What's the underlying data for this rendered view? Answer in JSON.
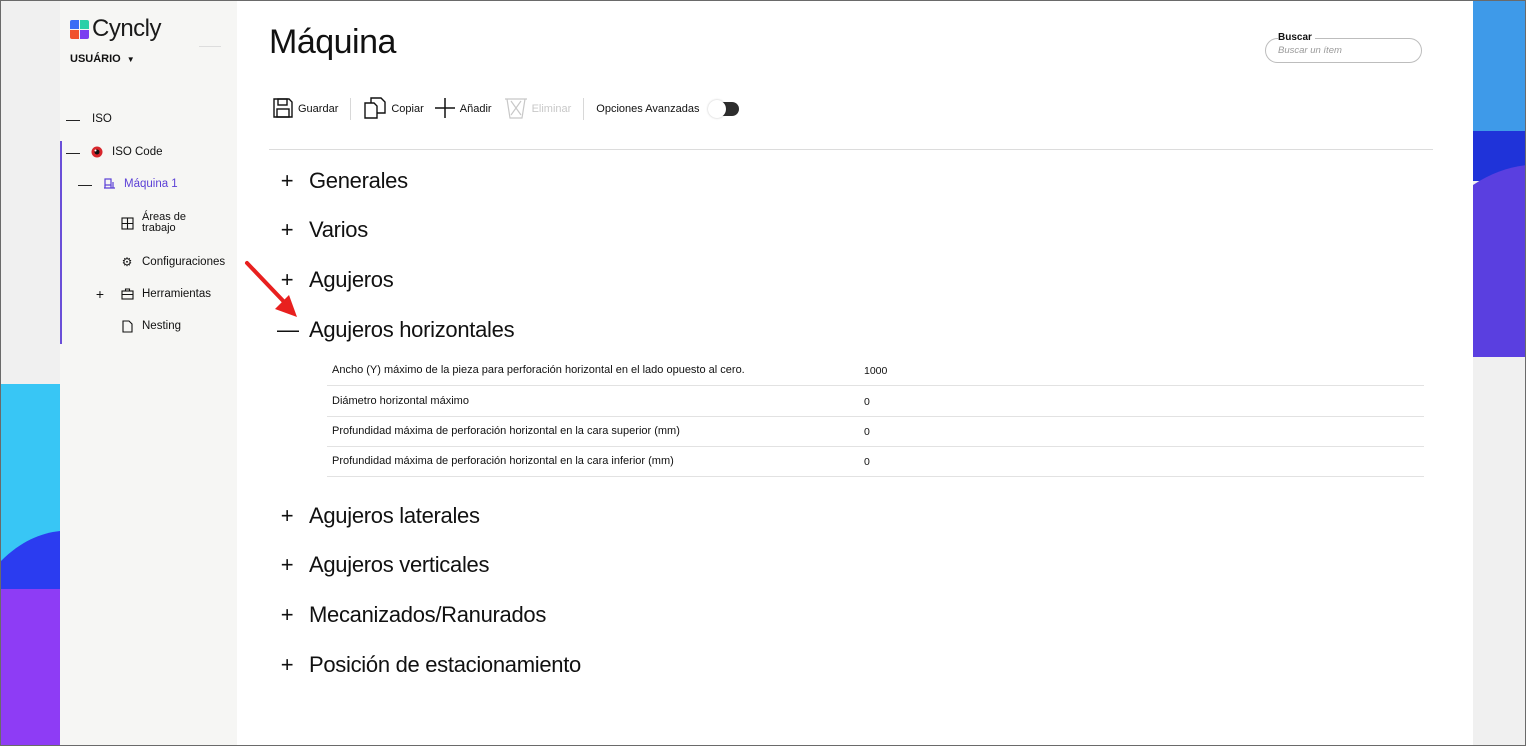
{
  "app": {
    "brand": "Cyncly",
    "user_menu": "USUÁRIO",
    "logo_colors": [
      "#3b6cf5",
      "#2bd0a8",
      "#f0532d",
      "#7b3cf0"
    ]
  },
  "sidebar": {
    "items": [
      {
        "toggle": "—",
        "icon": "",
        "label": "ISO"
      },
      {
        "toggle": "—",
        "icon": "iso-code-icon",
        "label": "ISO Code"
      },
      {
        "toggle": "—",
        "icon": "machine-icon",
        "label": "Máquina 1",
        "active": true
      },
      {
        "toggle": "",
        "icon": "grid-icon",
        "label": "Áreas de\ntrabajo"
      },
      {
        "toggle": "",
        "icon": "gear-icon",
        "label": "Configuraciones"
      },
      {
        "toggle": "+",
        "icon": "toolbox-icon",
        "label": "Herramientas"
      },
      {
        "toggle": "",
        "icon": "document-icon",
        "label": "Nesting"
      }
    ],
    "active_color": "#5b3fd6"
  },
  "main": {
    "title": "Máquina",
    "search": {
      "label": "Buscar",
      "placeholder": "Buscar un ítem"
    },
    "toolbar": {
      "save": "Guardar",
      "copy": "Copiar",
      "add": "Añadir",
      "delete": "Eliminar",
      "advanced": "Opciones Avanzadas",
      "advanced_enabled": false
    },
    "sections": [
      {
        "sign": "+",
        "title": "Generales"
      },
      {
        "sign": "+",
        "title": "Varios"
      },
      {
        "sign": "+",
        "title": "Agujeros"
      },
      {
        "sign": "—",
        "title": "Agujeros horizontales",
        "expanded": true
      },
      {
        "sign": "+",
        "title": "Agujeros laterales"
      },
      {
        "sign": "+",
        "title": "Agujeros verticales"
      },
      {
        "sign": "+",
        "title": "Mecanizados/Ranurados"
      },
      {
        "sign": "+",
        "title": "Posición de estacionamiento"
      }
    ],
    "properties": [
      {
        "label": "Ancho (Y) máximo de la pieza para perforación horizontal en el lado opuesto al cero.",
        "value": "1000"
      },
      {
        "label": "Diámetro horizontal máximo",
        "value": "0"
      },
      {
        "label": "Profundidad máxima de perforación horizontal en la cara superior (mm)",
        "value": "0"
      },
      {
        "label": "Profundidad máxima de perforación horizontal en la cara inferior (mm)",
        "value": "0"
      }
    ]
  },
  "annotation": {
    "arrow_color": "#e8201f"
  },
  "decor": {
    "left_colors": [
      "#f0f0f0",
      "#38c6f5",
      "#2b3cf0",
      "#8e3cf5"
    ],
    "right_colors": [
      "#3e9ae9",
      "#1f33d9",
      "#5a3fe0",
      "#f0f0f0"
    ]
  }
}
